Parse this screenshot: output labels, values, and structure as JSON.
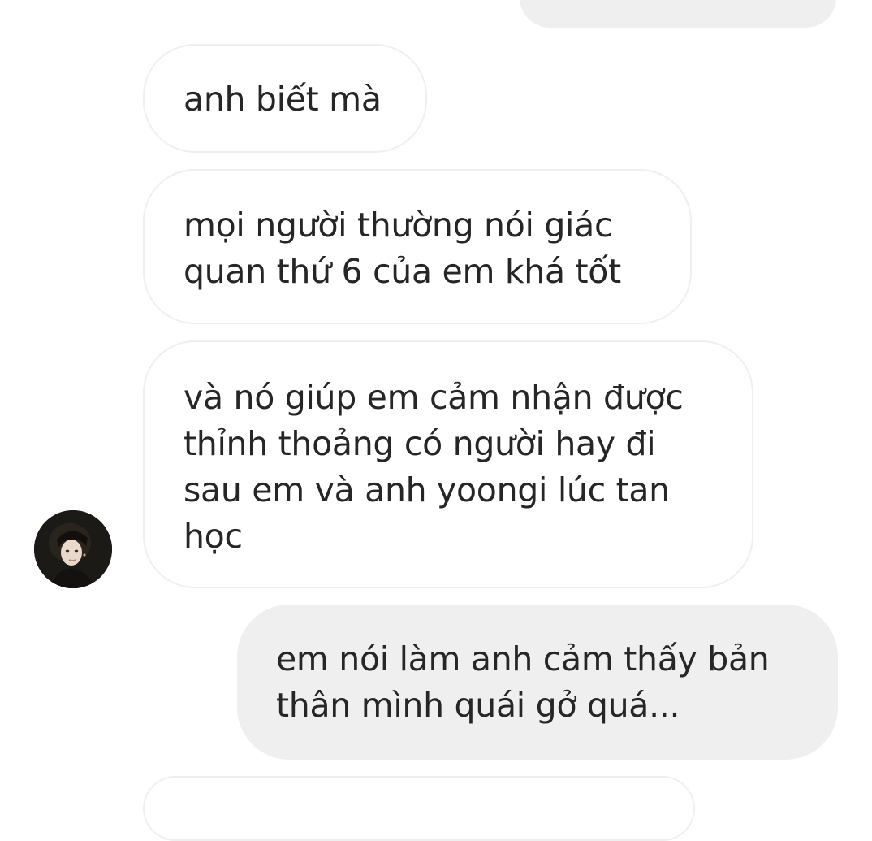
{
  "conversation": {
    "messages": [
      {
        "direction": "outgoing",
        "lines": []
      },
      {
        "direction": "incoming",
        "lines": [
          "anh biết mà"
        ]
      },
      {
        "direction": "incoming",
        "lines": [
          "mọi người thường nói giác",
          "quan thứ 6 của em khá tốt"
        ]
      },
      {
        "direction": "incoming",
        "lines": [
          "và nó giúp em cảm nhận được",
          "thỉnh thoảng có người hay đi",
          "sau em và anh yoongi lúc tan",
          "học"
        ]
      },
      {
        "direction": "outgoing",
        "lines": [
          "em nói làm anh cảm thấy bản",
          "thân mình quái gở quá..."
        ]
      },
      {
        "direction": "incoming",
        "lines": []
      }
    ]
  },
  "colors": {
    "incoming_bubble_bg": "#ffffff",
    "incoming_bubble_border": "#efefef",
    "outgoing_bubble_bg": "#efefef",
    "text": "#262626"
  },
  "icons": {
    "avatar": "sender-profile-photo"
  }
}
